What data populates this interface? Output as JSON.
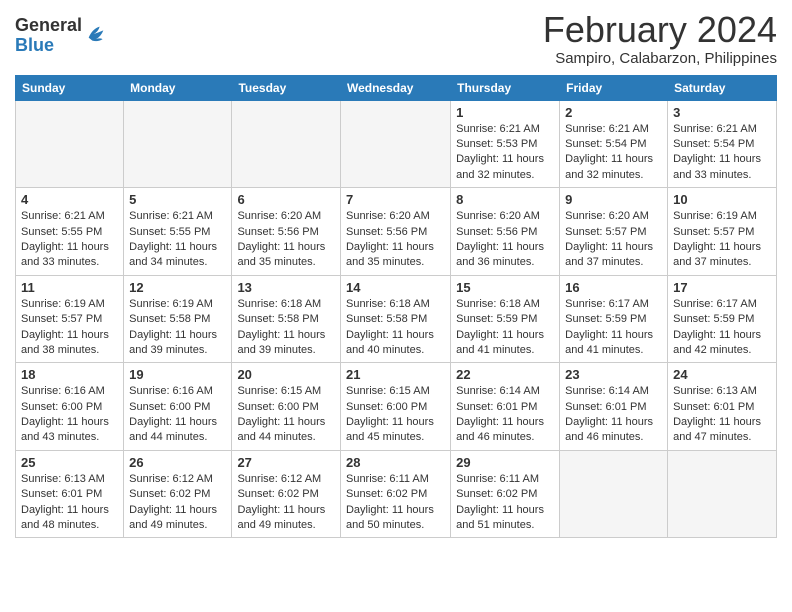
{
  "logo": {
    "general": "General",
    "blue": "Blue"
  },
  "title": "February 2024",
  "subtitle": "Sampiro, Calabarzon, Philippines",
  "days": [
    "Sunday",
    "Monday",
    "Tuesday",
    "Wednesday",
    "Thursday",
    "Friday",
    "Saturday"
  ],
  "weeks": [
    [
      {
        "day": "",
        "info": ""
      },
      {
        "day": "",
        "info": ""
      },
      {
        "day": "",
        "info": ""
      },
      {
        "day": "",
        "info": ""
      },
      {
        "day": "1",
        "info": "Sunrise: 6:21 AM\nSunset: 5:53 PM\nDaylight: 11 hours and 32 minutes."
      },
      {
        "day": "2",
        "info": "Sunrise: 6:21 AM\nSunset: 5:54 PM\nDaylight: 11 hours and 32 minutes."
      },
      {
        "day": "3",
        "info": "Sunrise: 6:21 AM\nSunset: 5:54 PM\nDaylight: 11 hours and 33 minutes."
      }
    ],
    [
      {
        "day": "4",
        "info": "Sunrise: 6:21 AM\nSunset: 5:55 PM\nDaylight: 11 hours and 33 minutes."
      },
      {
        "day": "5",
        "info": "Sunrise: 6:21 AM\nSunset: 5:55 PM\nDaylight: 11 hours and 34 minutes."
      },
      {
        "day": "6",
        "info": "Sunrise: 6:20 AM\nSunset: 5:56 PM\nDaylight: 11 hours and 35 minutes."
      },
      {
        "day": "7",
        "info": "Sunrise: 6:20 AM\nSunset: 5:56 PM\nDaylight: 11 hours and 35 minutes."
      },
      {
        "day": "8",
        "info": "Sunrise: 6:20 AM\nSunset: 5:56 PM\nDaylight: 11 hours and 36 minutes."
      },
      {
        "day": "9",
        "info": "Sunrise: 6:20 AM\nSunset: 5:57 PM\nDaylight: 11 hours and 37 minutes."
      },
      {
        "day": "10",
        "info": "Sunrise: 6:19 AM\nSunset: 5:57 PM\nDaylight: 11 hours and 37 minutes."
      }
    ],
    [
      {
        "day": "11",
        "info": "Sunrise: 6:19 AM\nSunset: 5:57 PM\nDaylight: 11 hours and 38 minutes."
      },
      {
        "day": "12",
        "info": "Sunrise: 6:19 AM\nSunset: 5:58 PM\nDaylight: 11 hours and 39 minutes."
      },
      {
        "day": "13",
        "info": "Sunrise: 6:18 AM\nSunset: 5:58 PM\nDaylight: 11 hours and 39 minutes."
      },
      {
        "day": "14",
        "info": "Sunrise: 6:18 AM\nSunset: 5:58 PM\nDaylight: 11 hours and 40 minutes."
      },
      {
        "day": "15",
        "info": "Sunrise: 6:18 AM\nSunset: 5:59 PM\nDaylight: 11 hours and 41 minutes."
      },
      {
        "day": "16",
        "info": "Sunrise: 6:17 AM\nSunset: 5:59 PM\nDaylight: 11 hours and 41 minutes."
      },
      {
        "day": "17",
        "info": "Sunrise: 6:17 AM\nSunset: 5:59 PM\nDaylight: 11 hours and 42 minutes."
      }
    ],
    [
      {
        "day": "18",
        "info": "Sunrise: 6:16 AM\nSunset: 6:00 PM\nDaylight: 11 hours and 43 minutes."
      },
      {
        "day": "19",
        "info": "Sunrise: 6:16 AM\nSunset: 6:00 PM\nDaylight: 11 hours and 44 minutes."
      },
      {
        "day": "20",
        "info": "Sunrise: 6:15 AM\nSunset: 6:00 PM\nDaylight: 11 hours and 44 minutes."
      },
      {
        "day": "21",
        "info": "Sunrise: 6:15 AM\nSunset: 6:00 PM\nDaylight: 11 hours and 45 minutes."
      },
      {
        "day": "22",
        "info": "Sunrise: 6:14 AM\nSunset: 6:01 PM\nDaylight: 11 hours and 46 minutes."
      },
      {
        "day": "23",
        "info": "Sunrise: 6:14 AM\nSunset: 6:01 PM\nDaylight: 11 hours and 46 minutes."
      },
      {
        "day": "24",
        "info": "Sunrise: 6:13 AM\nSunset: 6:01 PM\nDaylight: 11 hours and 47 minutes."
      }
    ],
    [
      {
        "day": "25",
        "info": "Sunrise: 6:13 AM\nSunset: 6:01 PM\nDaylight: 11 hours and 48 minutes."
      },
      {
        "day": "26",
        "info": "Sunrise: 6:12 AM\nSunset: 6:02 PM\nDaylight: 11 hours and 49 minutes."
      },
      {
        "day": "27",
        "info": "Sunrise: 6:12 AM\nSunset: 6:02 PM\nDaylight: 11 hours and 49 minutes."
      },
      {
        "day": "28",
        "info": "Sunrise: 6:11 AM\nSunset: 6:02 PM\nDaylight: 11 hours and 50 minutes."
      },
      {
        "day": "29",
        "info": "Sunrise: 6:11 AM\nSunset: 6:02 PM\nDaylight: 11 hours and 51 minutes."
      },
      {
        "day": "",
        "info": ""
      },
      {
        "day": "",
        "info": ""
      }
    ]
  ]
}
